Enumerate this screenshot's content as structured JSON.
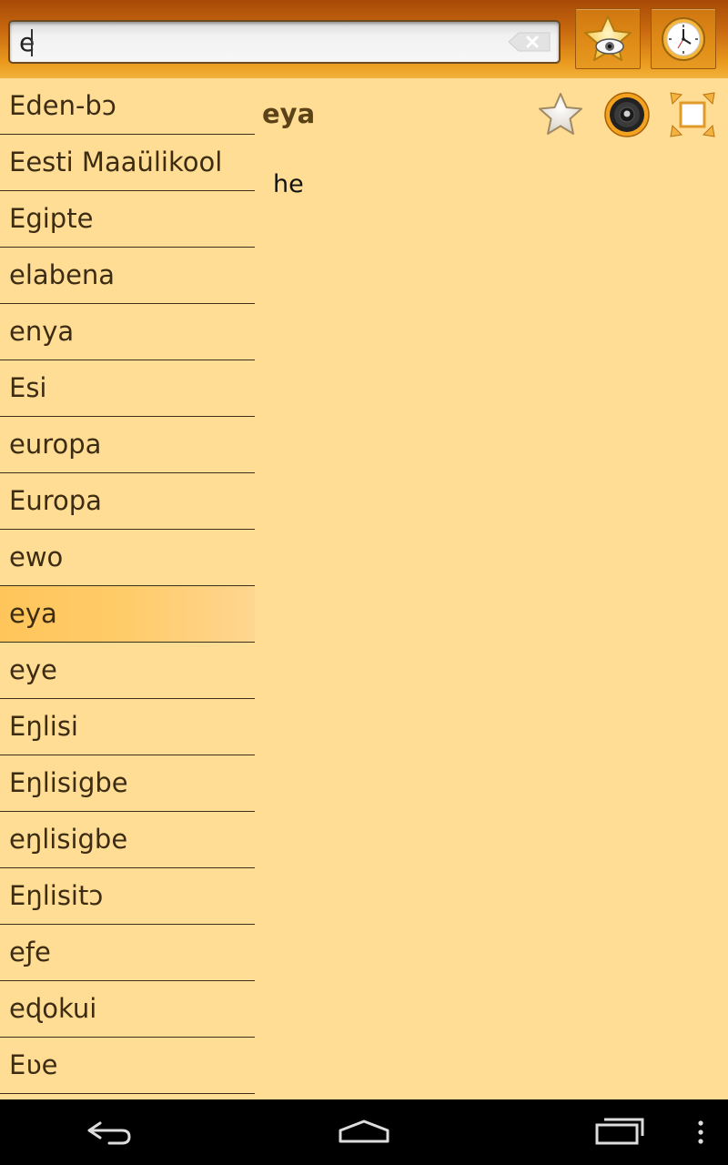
{
  "search": {
    "value": "e"
  },
  "toolbar": {
    "favorites_icon": "star-eye-icon",
    "history_icon": "clock-icon"
  },
  "word_list": {
    "selected_index": 9,
    "items": [
      {
        "label": "Eden-bɔ"
      },
      {
        "label": "Eesti Maaülikool"
      },
      {
        "label": "Egipte"
      },
      {
        "label": "elabena"
      },
      {
        "label": "enya"
      },
      {
        "label": "Esi"
      },
      {
        "label": "europa"
      },
      {
        "label": "Europa"
      },
      {
        "label": "ewo"
      },
      {
        "label": "eya"
      },
      {
        "label": "eye"
      },
      {
        "label": "Eŋlisi"
      },
      {
        "label": "Eŋlisigbe"
      },
      {
        "label": "eŋlisigbe"
      },
      {
        "label": "Eŋlisitɔ"
      },
      {
        "label": "eƒe"
      },
      {
        "label": "eɖokui"
      },
      {
        "label": "Eʋe"
      }
    ]
  },
  "detail": {
    "headword": "eya",
    "translation": "he",
    "actions": [
      "star-icon",
      "speaker-icon",
      "fullscreen-icon"
    ]
  },
  "colors": {
    "background": "#FFDD94",
    "selected_row": "#FFC55A",
    "accent": "#E08D18"
  },
  "navigation": {
    "icons": [
      "back-icon",
      "home-icon",
      "recent-apps-icon",
      "overflow-menu-icon"
    ]
  }
}
